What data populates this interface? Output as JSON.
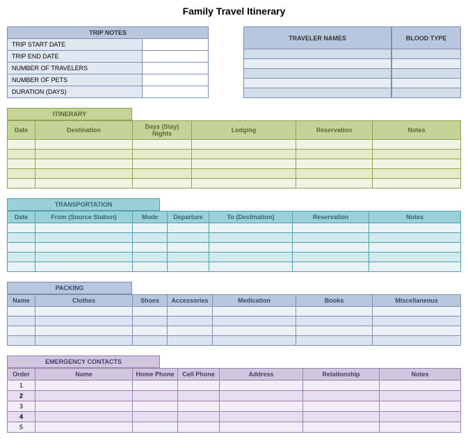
{
  "title": "Family Travel Itinerary",
  "trip_notes": {
    "header": "TRIP NOTES",
    "rows": [
      "TRIP START DATE",
      "TRIP END DATE",
      "NUMBER OF TRAVELERS",
      "NUMBER OF PETS",
      "DURATION (DAYS)"
    ]
  },
  "traveler_names": {
    "header": "TRAVELER NAMES",
    "rows": 5
  },
  "blood_type": {
    "header": "BLOOD TYPE",
    "rows": 5
  },
  "itinerary": {
    "title": "ITINERARY",
    "cols": [
      "Date",
      "Destination",
      "Days (Stay) Nights",
      "Lodging",
      "Reservation",
      "Notes"
    ],
    "rows": 5
  },
  "transportation": {
    "title": "TRANSPORTATION",
    "cols": [
      "Date",
      "From (Source Station)",
      "Mode",
      "Departure",
      "To (Destination)",
      "Reservation",
      "Notes"
    ],
    "rows": 5
  },
  "packing": {
    "title": "PACKING",
    "cols": [
      "Name",
      "Clothes",
      "Shoes",
      "Accessories",
      "Medication",
      "Books",
      "Miscellaneous"
    ],
    "rows": 4
  },
  "emergency": {
    "title": "EMERGENCY CONTACTS",
    "cols": [
      "Order",
      "Name",
      "Home Phone",
      "Cell Phone",
      "Address",
      "Relationship",
      "Notes"
    ],
    "orders": [
      "1",
      "2",
      "3",
      "4",
      "5"
    ]
  }
}
